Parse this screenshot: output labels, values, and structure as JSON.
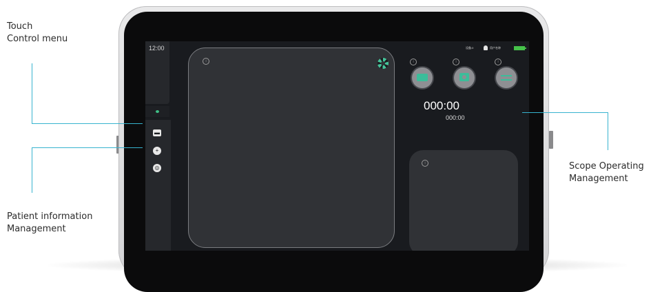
{
  "callouts": {
    "touch_control": [
      "Touch",
      "Control menu"
    ],
    "patient_info": [
      "Patient information",
      "Management"
    ],
    "scope_operating": [
      "Scope Operating",
      "Management"
    ]
  },
  "screen": {
    "time": "12:00",
    "status": {
      "device": "设备:0",
      "user": "用户名称"
    },
    "timer_main": "000:00",
    "timer_sub": "000:00"
  },
  "colors": {
    "accent": "#3bbd9a",
    "callout_line": "#37b3cf",
    "battery": "#46c24a",
    "screen_bg": "#191b1f",
    "panel_bg": "#303236"
  },
  "icons": {
    "sidebar": [
      "eye-icon",
      "folder-icon",
      "add-user-icon",
      "settings-icon"
    ],
    "controls": [
      "video-record-icon",
      "camera-icon",
      "swap-icon"
    ],
    "main": [
      "aperture-icon",
      "info-icon"
    ]
  }
}
